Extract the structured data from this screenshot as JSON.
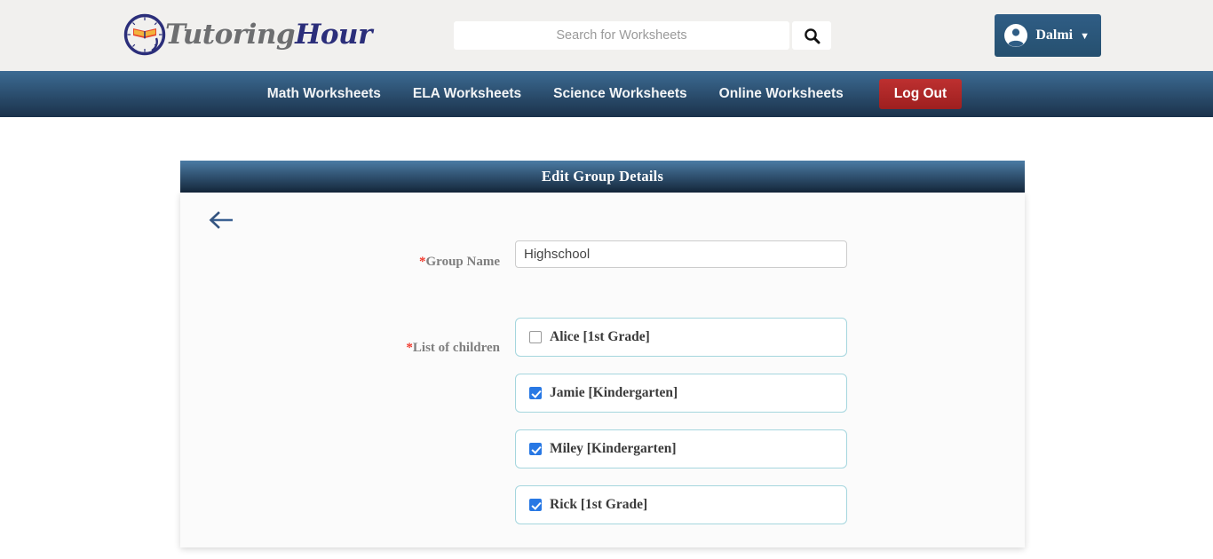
{
  "brand": {
    "name_part1": "Tutoring",
    "name_part2": "Hour",
    "logo_icon": "clock-book-icon"
  },
  "search": {
    "placeholder": "Search for Worksheets",
    "value": "",
    "button_icon": "search-icon"
  },
  "account": {
    "username": "Dalmi",
    "avatar_icon": "user-circle-icon",
    "caret": "▼"
  },
  "nav": {
    "items": [
      {
        "label": "Math Worksheets"
      },
      {
        "label": "ELA Worksheets"
      },
      {
        "label": "Science Worksheets"
      },
      {
        "label": "Online Worksheets"
      }
    ],
    "logout_label": "Log Out"
  },
  "card": {
    "title": "Edit Group Details",
    "back_icon": "arrow-left-icon"
  },
  "form": {
    "group_name": {
      "label": "Group Name",
      "required_mark": "*",
      "value": "Highschool",
      "placeholder": ""
    },
    "children": {
      "label": "List of children",
      "required_mark": "*",
      "items": [
        {
          "name": "Alice [1st Grade]",
          "checked": false
        },
        {
          "name": "Jamie [Kindergarten]",
          "checked": true
        },
        {
          "name": "Miley [Kindergarten]",
          "checked": true
        },
        {
          "name": "Rick [1st Grade]",
          "checked": true
        }
      ]
    }
  },
  "colors": {
    "topbar_bg": "#f1f0ee",
    "nav_bg_top": "#3c6b93",
    "nav_bg_bottom": "#1b324b",
    "logout_red": "#bd3030",
    "checkbox_blue": "#2878e4",
    "row_border": "#a5d6de",
    "required_red": "#f0382b",
    "label_gray": "#7f7f7f"
  }
}
